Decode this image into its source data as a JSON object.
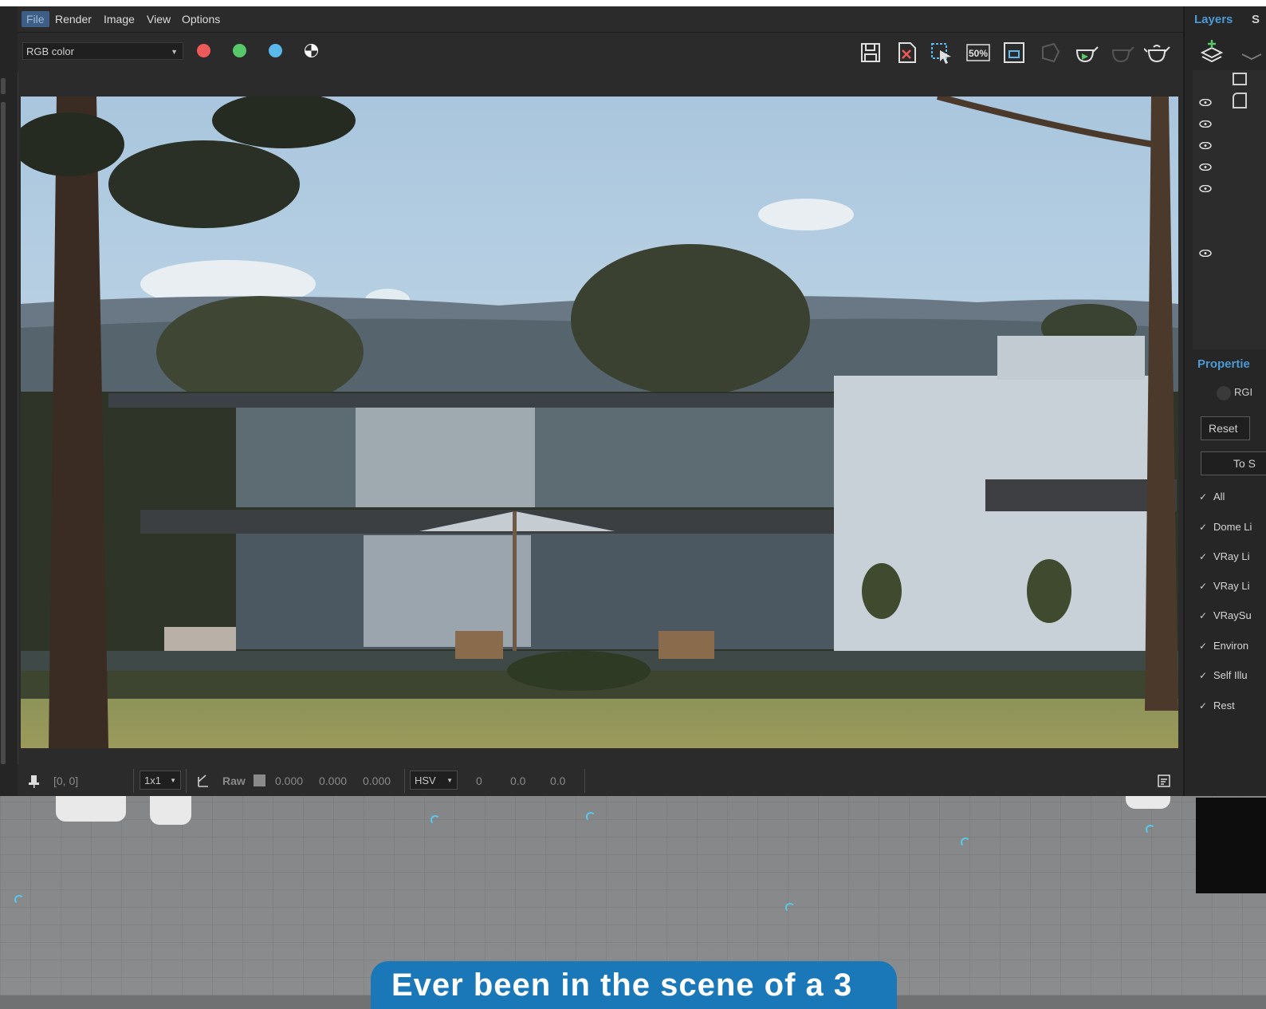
{
  "menu": {
    "items": [
      "File",
      "Render",
      "Image",
      "View",
      "Options"
    ],
    "active": "File"
  },
  "toolbar": {
    "channel_value": "RGB color",
    "channels": [
      {
        "name": "red",
        "color": "#ee5a5a"
      },
      {
        "name": "green",
        "color": "#56c86a"
      },
      {
        "name": "blue",
        "color": "#5ab8ec"
      },
      {
        "name": "alpha",
        "color": "#ffffff"
      }
    ],
    "zoom_icon_text": "50%"
  },
  "statusbar": {
    "coords": "[0, 0]",
    "sample_size": "1x1",
    "raw_label": "Raw",
    "rgb_values": [
      "0.000",
      "0.000",
      "0.000"
    ],
    "color_mode": "HSV",
    "hsv_values": [
      "0",
      "0.0",
      "0.0"
    ]
  },
  "right_panel": {
    "tab_layers": "Layers",
    "tab_partial": "S",
    "properties_title": "Propertie",
    "rgb_partial": "RGI",
    "reset_label": "Reset",
    "to_partial": "To S",
    "checks": [
      "All",
      "Dome Li",
      "VRay Li",
      "VRay Li",
      "VRaySu",
      "Environ",
      "Self Illu",
      "Rest"
    ]
  },
  "banner": {
    "text": "Ever been in the scene of a 3"
  },
  "colors": {
    "accent": "#4a9ad6",
    "banner": "#1a78b8",
    "ui_bg": "#2b2b2b"
  }
}
